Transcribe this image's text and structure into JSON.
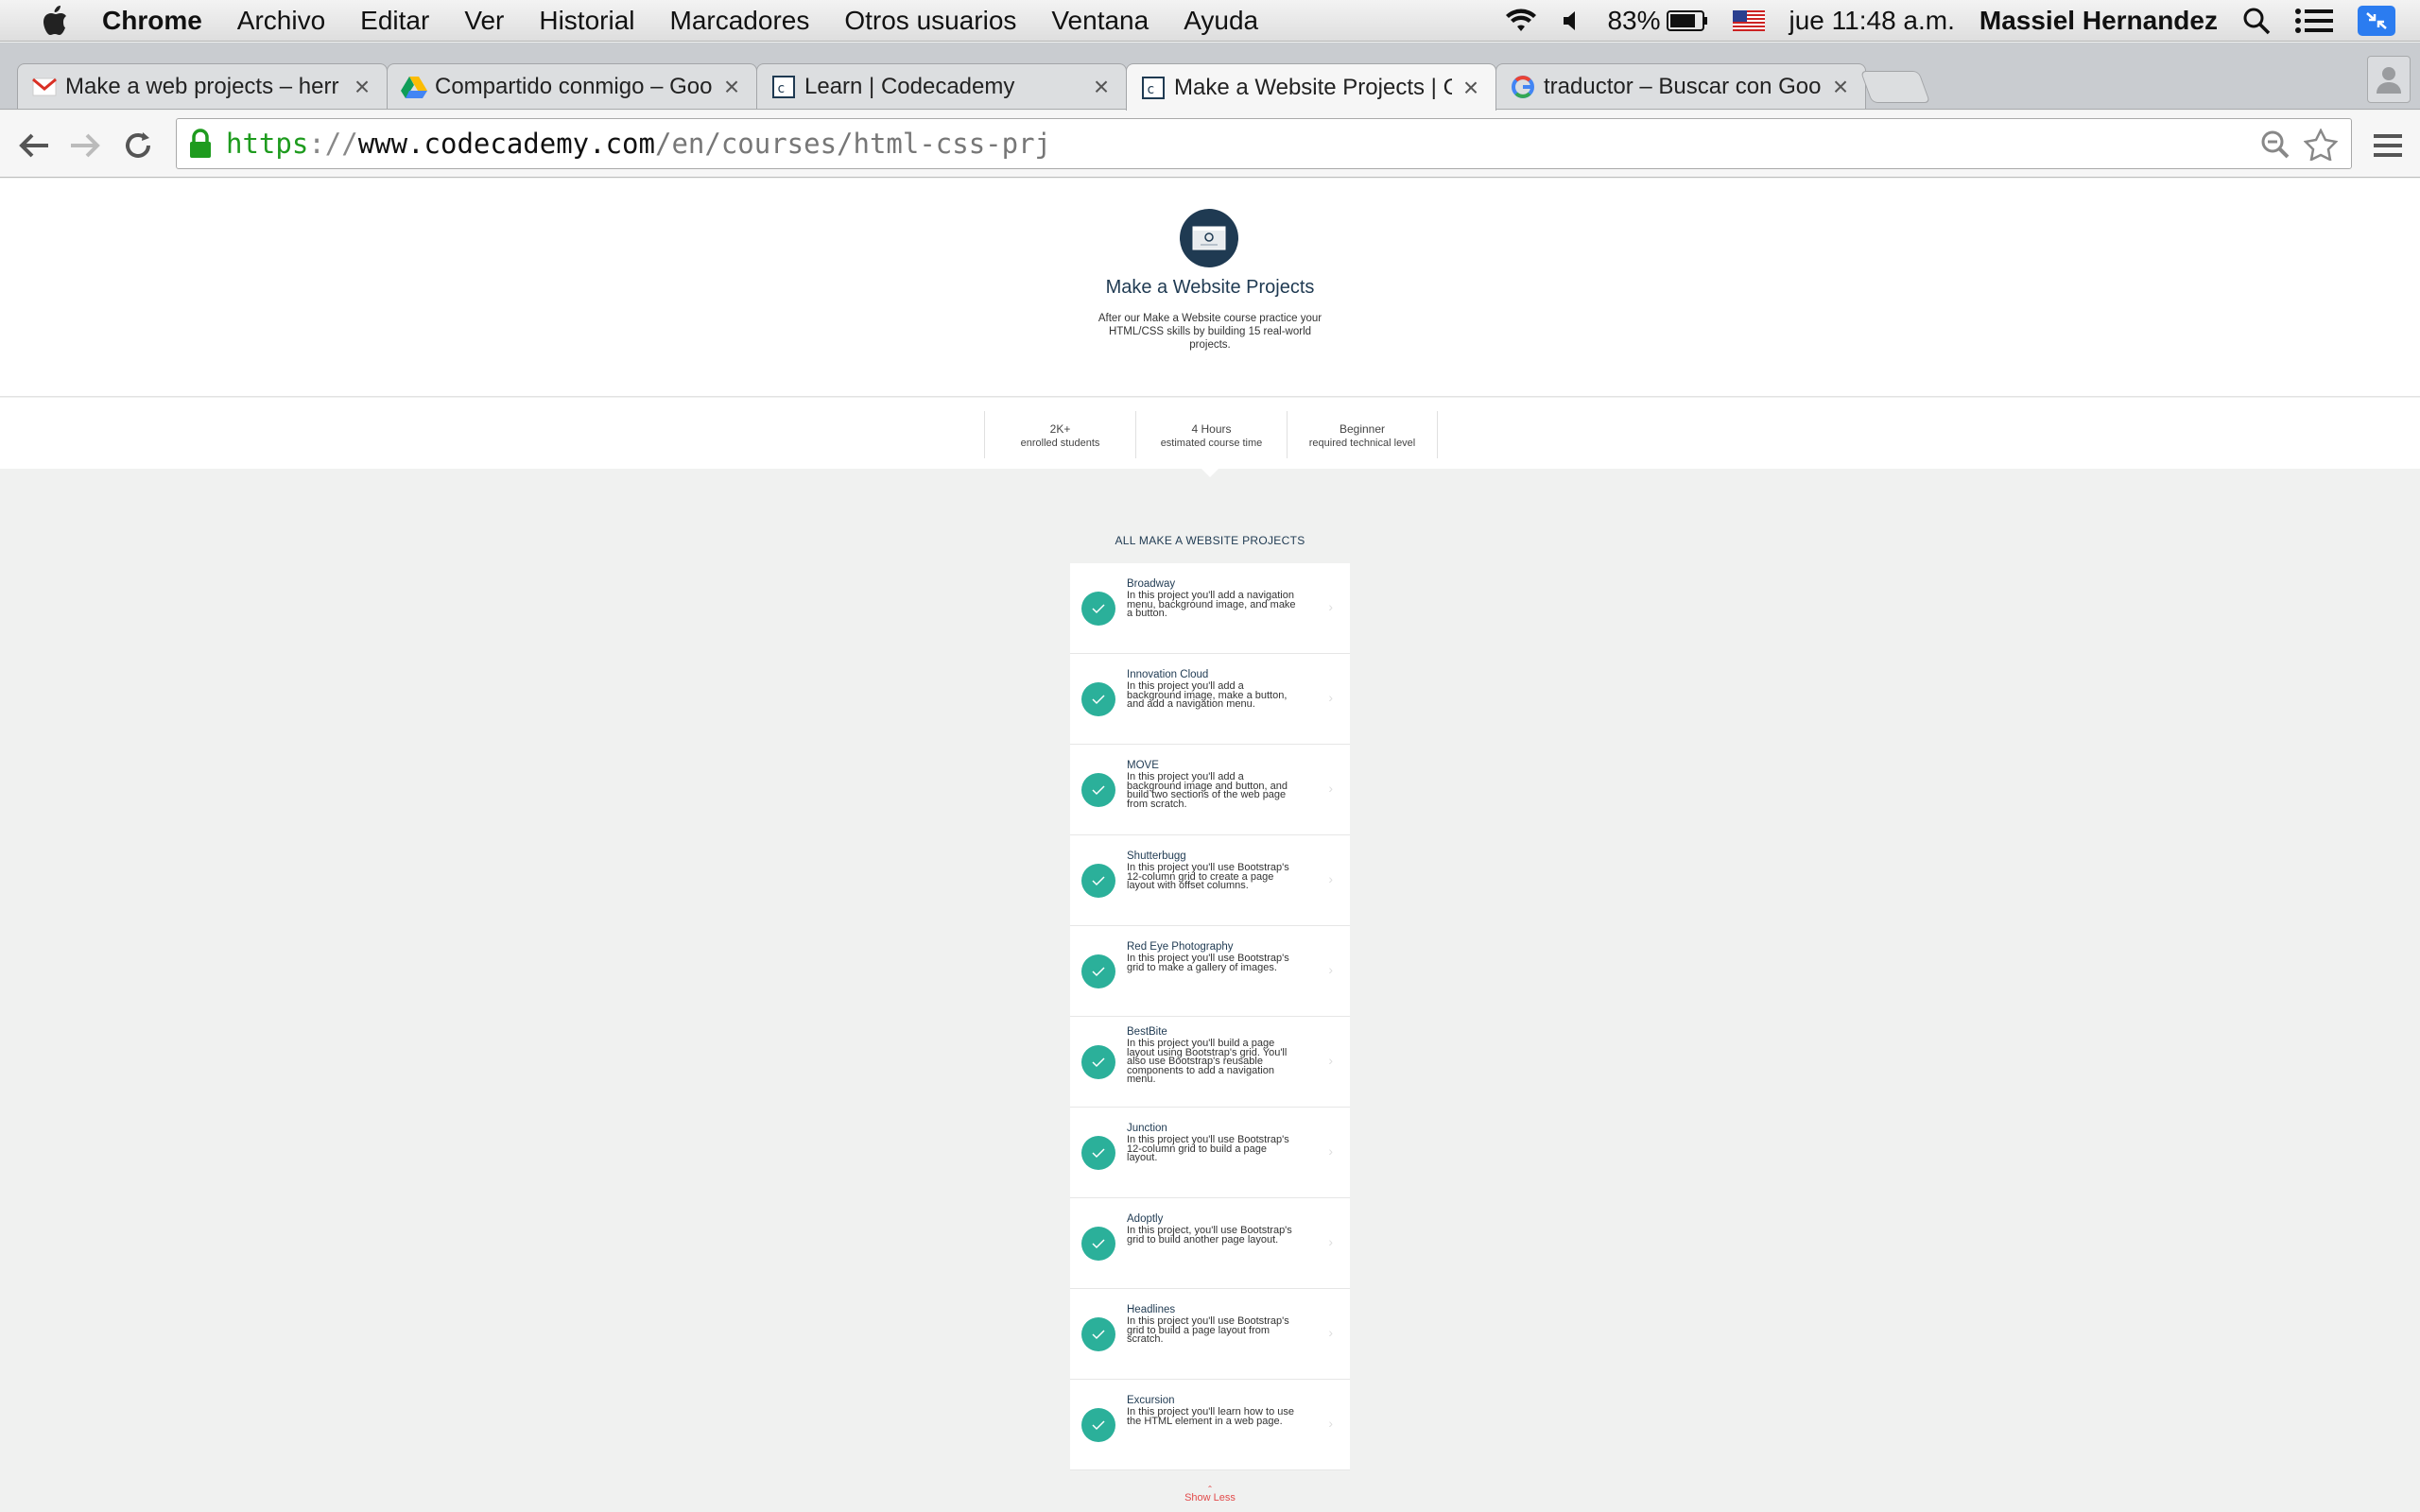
{
  "menubar": {
    "app": "Chrome",
    "items": [
      "Archivo",
      "Editar",
      "Ver",
      "Historial",
      "Marcadores",
      "Otros usuarios",
      "Ventana",
      "Ayuda"
    ],
    "battery": "83%",
    "clock": "jue 11:48 a.m.",
    "user": "Massiel Hernandez"
  },
  "tabs": [
    {
      "title": "Make a web projects – herr",
      "icon": "gmail-icon"
    },
    {
      "title": "Compartido conmigo – Goo",
      "icon": "drive-icon"
    },
    {
      "title": "Learn | Codecademy",
      "icon": "codecademy-icon"
    },
    {
      "title": "Make a Website Projects | C",
      "icon": "codecademy-icon"
    },
    {
      "title": "traductor – Buscar con Goo",
      "icon": "google-icon"
    }
  ],
  "url": {
    "scheme": "https",
    "sep": "://",
    "host": "www.codecademy.com",
    "path": "/en/courses/html-css-prj"
  },
  "course": {
    "title": "Make a Website Projects",
    "description": "After our Make a Website course practice your HTML/CSS skills by building 15 real-world projects."
  },
  "stats": [
    {
      "value": "2K+",
      "label": "enrolled students"
    },
    {
      "value": "4 Hours",
      "label": "estimated course time"
    },
    {
      "value": "Beginner",
      "label": "required technical level"
    }
  ],
  "projects_heading": "ALL MAKE A WEBSITE PROJECTS",
  "projects": [
    {
      "name": "Broadway",
      "desc": "In this project you'll add a navigation menu, background image, and make a button."
    },
    {
      "name": "Innovation Cloud",
      "desc": "In this project you'll add a background image, make a button, and add a navigation menu."
    },
    {
      "name": "MOVE",
      "desc": "In this project you'll add a background image and button, and build two sections of the web page from scratch."
    },
    {
      "name": "Shutterbugg",
      "desc": "In this project you'll use Bootstrap's 12-column grid to create a page layout with offset columns."
    },
    {
      "name": "Red Eye Photography",
      "desc": "In this project you'll use Bootstrap's grid to make a gallery of images."
    },
    {
      "name": "BestBite",
      "desc": "In this project you'll build a page layout using Bootstrap's grid. You'll also use Bootstrap's reusable components to add a navigation menu."
    },
    {
      "name": "Junction",
      "desc": "In this project you'll use Bootstrap's 12-column grid to build a page layout."
    },
    {
      "name": "Adoptly",
      "desc": "In this project, you'll use Bootstrap's grid to build another page layout."
    },
    {
      "name": "Headlines",
      "desc": "In this project you'll use Bootstrap's grid to build a page layout from scratch."
    },
    {
      "name": "Excursion",
      "desc": "In this project you'll learn how to use the HTML element in a web page."
    }
  ],
  "show_less": "Show Less",
  "colors": {
    "accent": "#2bb09a",
    "navy": "#1f3a52",
    "link_red": "#e24b4b"
  }
}
